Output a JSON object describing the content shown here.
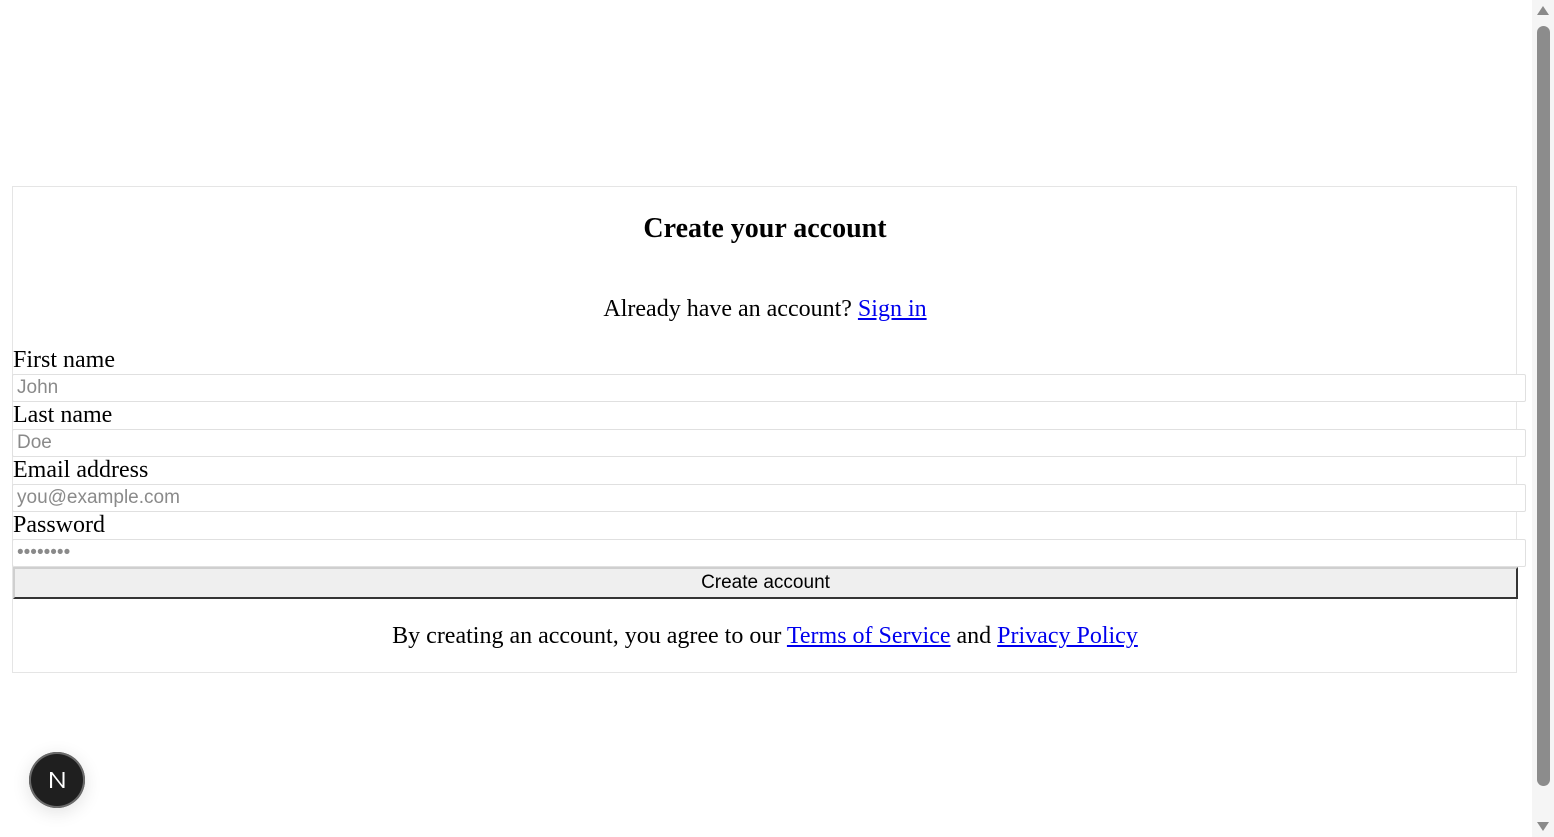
{
  "form": {
    "title": "Create your account",
    "signin_prompt": "Already have an account?",
    "signin_link": "Sign in",
    "fields": [
      {
        "label": "First name",
        "placeholder": "John",
        "value": ""
      },
      {
        "label": "Last name",
        "placeholder": "Doe",
        "value": ""
      },
      {
        "label": "Email address",
        "placeholder": "you@example.com",
        "value": ""
      },
      {
        "label": "Password",
        "placeholder": "••••••••",
        "value": ""
      }
    ],
    "submit_label": "Create account",
    "terms_prefix": "By creating an account, you agree to our",
    "terms_link": "Terms of Service",
    "terms_and": "and",
    "privacy_link": "Privacy Policy"
  },
  "badge": {
    "icon": "nextjs-n-icon",
    "letter": "N"
  }
}
